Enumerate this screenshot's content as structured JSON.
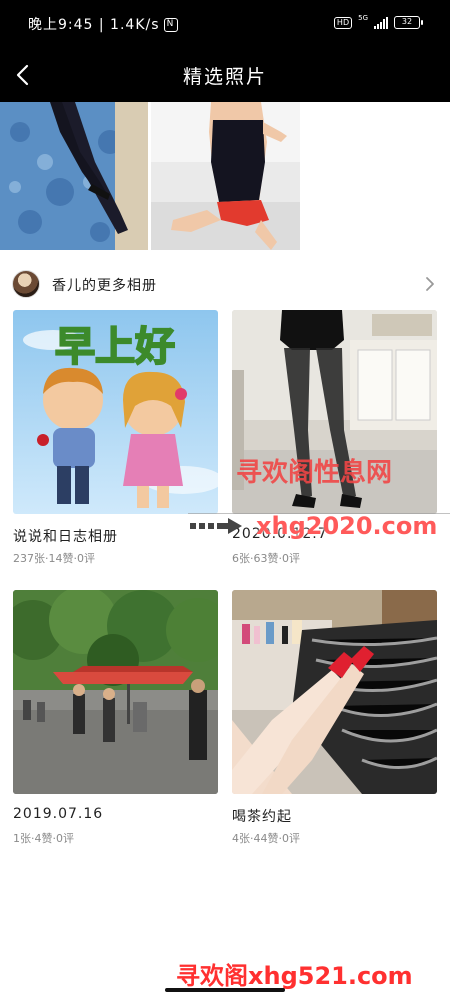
{
  "status_bar": {
    "time_network": "晚上9:45 | 1.4K/s",
    "nfc": "N",
    "hd": "HD",
    "signal": "5G",
    "battery": "32"
  },
  "header": {
    "title": "精选照片",
    "back_icon": "chevron-left-icon"
  },
  "album_section": {
    "owner_label": "香儿的更多相册",
    "more_icon": "chevron-right-icon"
  },
  "albums": [
    {
      "title": "说说和日志相册",
      "meta": "237张·14赞·0评"
    },
    {
      "title": "2020.0.12.7",
      "meta": "6张·63赞·0评"
    },
    {
      "title": "2019.07.16",
      "meta": "1张·4赞·0评"
    },
    {
      "title": "喝茶约起",
      "meta": "4张·44赞·0评"
    }
  ],
  "thumb_text": {
    "greeting": "早上好"
  },
  "watermarks": {
    "wm1": "寻欢阁性息网",
    "wm2": "xhg2020.com",
    "wm3": "寻欢阁xhg521.com"
  },
  "colors": {
    "header_bg": "#000000",
    "watermark_red": "#f04040",
    "meta_gray": "#8a8a8a"
  }
}
